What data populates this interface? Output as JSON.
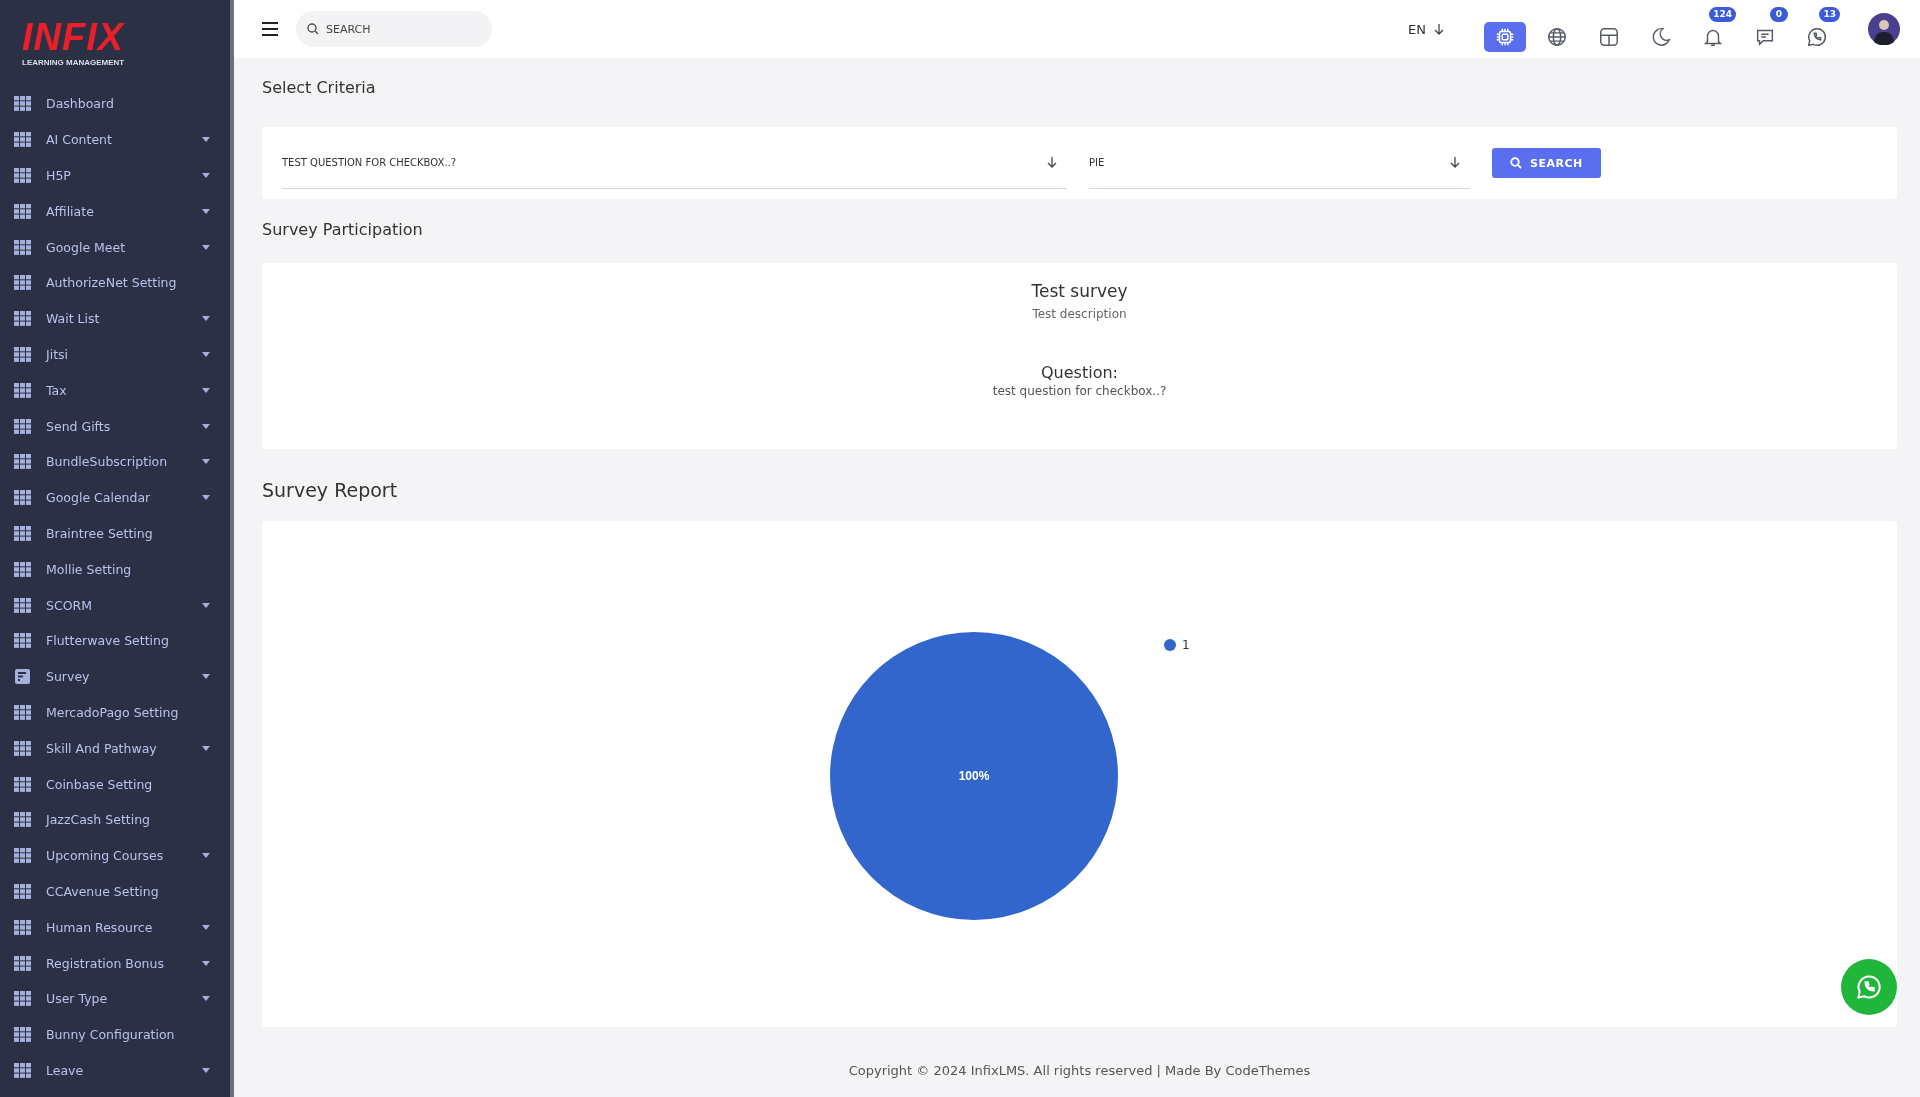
{
  "logo": {
    "name": "INFIX",
    "subtitle": "LEARNING MANAGEMENT"
  },
  "sidebar": {
    "items": [
      {
        "label": "Dashboard",
        "kind": "grid",
        "expandable": false
      },
      {
        "label": "AI Content",
        "kind": "grid",
        "expandable": true
      },
      {
        "label": "H5P",
        "kind": "grid",
        "expandable": true
      },
      {
        "label": "Affiliate",
        "kind": "grid",
        "expandable": true
      },
      {
        "label": "Google Meet",
        "kind": "grid",
        "expandable": true
      },
      {
        "label": "AuthorizeNet Setting",
        "kind": "grid",
        "expandable": false
      },
      {
        "label": "Wait List",
        "kind": "grid",
        "expandable": true
      },
      {
        "label": "Jitsi",
        "kind": "grid",
        "expandable": true
      },
      {
        "label": "Tax",
        "kind": "grid",
        "expandable": true
      },
      {
        "label": "Send Gifts",
        "kind": "grid",
        "expandable": true
      },
      {
        "label": "BundleSubscription",
        "kind": "grid",
        "expandable": true
      },
      {
        "label": "Google Calendar",
        "kind": "grid",
        "expandable": true
      },
      {
        "label": "Braintree Setting",
        "kind": "grid",
        "expandable": false
      },
      {
        "label": "Mollie Setting",
        "kind": "grid",
        "expandable": false
      },
      {
        "label": "SCORM",
        "kind": "grid",
        "expandable": true
      },
      {
        "label": "Flutterwave Setting",
        "kind": "grid",
        "expandable": false
      },
      {
        "label": "Survey",
        "kind": "form",
        "expandable": true
      },
      {
        "label": "MercadoPago Setting",
        "kind": "grid",
        "expandable": false
      },
      {
        "label": "Skill And Pathway",
        "kind": "grid",
        "expandable": true
      },
      {
        "label": "Coinbase Setting",
        "kind": "grid",
        "expandable": false
      },
      {
        "label": "JazzCash Setting",
        "kind": "grid",
        "expandable": false
      },
      {
        "label": "Upcoming Courses",
        "kind": "grid",
        "expandable": true
      },
      {
        "label": "CCAvenue Setting",
        "kind": "grid",
        "expandable": false
      },
      {
        "label": "Human Resource",
        "kind": "grid",
        "expandable": true
      },
      {
        "label": "Registration Bonus",
        "kind": "grid",
        "expandable": true
      },
      {
        "label": "User Type",
        "kind": "grid",
        "expandable": true
      },
      {
        "label": "Bunny Configuration",
        "kind": "grid",
        "expandable": false
      },
      {
        "label": "Leave",
        "kind": "grid",
        "expandable": true
      }
    ]
  },
  "header": {
    "search": {
      "placeholder": "SEARCH"
    },
    "language": "EN",
    "icons": [
      {
        "kind": "ai",
        "selected": true
      },
      {
        "kind": "globe",
        "selected": false
      },
      {
        "kind": "layout",
        "selected": false
      },
      {
        "kind": "moon",
        "selected": false
      },
      {
        "kind": "bell",
        "selected": false,
        "badge": "124"
      },
      {
        "kind": "chat",
        "selected": false,
        "badge": "0"
      },
      {
        "kind": "whatsapp",
        "selected": false,
        "badge": "13"
      }
    ]
  },
  "criteria": {
    "title": "Select Criteria",
    "question": "TEST QUESTION FOR CHECKBOX..?",
    "chart_type": "PIE",
    "button": "SEARCH"
  },
  "participation": {
    "title": "Survey Participation",
    "survey_title": "Test survey",
    "survey_description": "Test description",
    "question_label": "Question:",
    "question": "test question for checkbox..?"
  },
  "report": {
    "title": "Survey Report",
    "chart_data": {
      "type": "pie",
      "categories": [
        "1"
      ],
      "data_labels": true,
      "value_labels": [
        "100%"
      ]
    }
  },
  "footer": "Copyright © 2024 InfixLMS. All rights reserved | Made By CodeThemes"
}
